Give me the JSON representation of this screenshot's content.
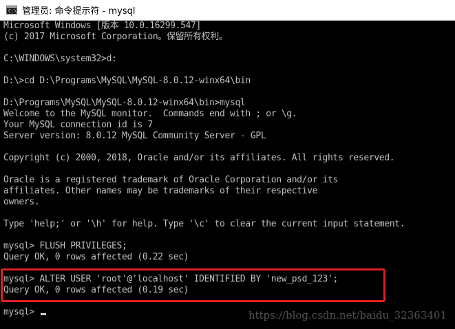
{
  "window": {
    "icon_text": "C:\\",
    "title": "管理员: 命令提示符 - mysql"
  },
  "console": {
    "lines": [
      "Microsoft Windows [版本 10.0.16299.547]",
      "(c) 2017 Microsoft Corporation。保留所有权利。",
      "",
      "C:\\WINDOWS\\system32>d:",
      "",
      "D:\\>cd D:\\Programs\\MySQL\\MySQL-8.0.12-winx64\\bin",
      "",
      "D:\\Programs\\MySQL\\MySQL-8.0.12-winx64\\bin>mysql",
      "Welcome to the MySQL monitor.  Commands end with ; or \\g.",
      "Your MySQL connection id is 7",
      "Server version: 8.0.12 MySQL Community Server - GPL",
      "",
      "Copyright (c) 2000, 2018, Oracle and/or its affiliates. All rights reserved.",
      "",
      "Oracle is a registered trademark of Oracle Corporation and/or its",
      "affiliates. Other names may be trademarks of their respective",
      "owners.",
      "",
      "Type 'help;' or '\\h' for help. Type '\\c' to clear the current input statement.",
      "",
      "mysql> FLUSH PRIVILEGES;",
      "Query OK, 0 rows affected (0.22 sec)",
      "",
      "mysql> ALTER USER 'root'@'localhost' IDENTIFIED BY 'new_psd_123';",
      "Query OK, 0 rows affected (0.19 sec)",
      "",
      "mysql> "
    ]
  },
  "watermark": "https://blog.csdn.net/baidu_32363401",
  "colors": {
    "console_bg": "#000000",
    "console_text": "#c0c0c0",
    "highlight_border": "#e02020",
    "titlebar_bg": "#ffffff"
  }
}
